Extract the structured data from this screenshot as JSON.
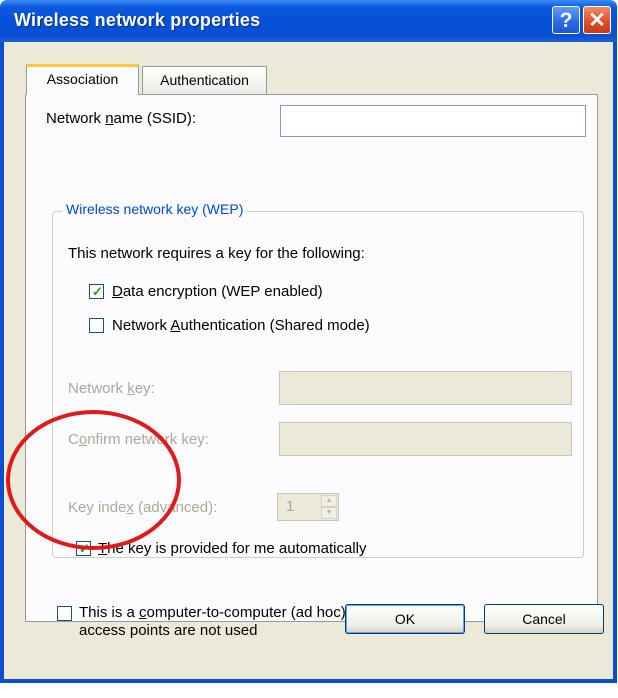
{
  "window": {
    "title": "Wireless network properties",
    "help_glyph": "?",
    "close_glyph": "✕"
  },
  "tabs": [
    {
      "label": "Association",
      "active": true
    },
    {
      "label": "Authentication",
      "active": false
    }
  ],
  "association": {
    "ssid_label_pre": "Network ",
    "ssid_label_accel": "n",
    "ssid_label_post": "ame (SSID):",
    "ssid_value": "",
    "group_title": "Wireless network key (WEP)",
    "requires_text": "This network requires a key for the following:",
    "data_encryption": {
      "accel": "D",
      "rest": "ata encryption (WEP enabled)",
      "checked": true
    },
    "network_auth": {
      "pre": "Network ",
      "accel": "A",
      "rest": "uthentication (Shared mode)",
      "checked": false
    },
    "network_key": {
      "pre": "Network ",
      "accel": "k",
      "rest": "ey:",
      "value": ""
    },
    "confirm_key": {
      "pre": "C",
      "accel": "o",
      "rest": "nfirm network key:",
      "value": ""
    },
    "key_index": {
      "pre": "Key inde",
      "accel": "x",
      "rest": " (advanced):",
      "value": "1"
    },
    "auto_key": {
      "accel": "T",
      "rest": "he key is provided for me automatically",
      "checked": true
    },
    "adhoc": {
      "pre": "This is a ",
      "accel": "c",
      "rest": "omputer-to-computer (ad hoc) network; wireless",
      "line2": "access points are not used",
      "checked": false
    }
  },
  "buttons": {
    "ok": "OK",
    "cancel": "Cancel"
  },
  "colors": {
    "titlebar": "#0452d8",
    "client": "#ece9d8",
    "annotation": "#e01a1a",
    "group_title": "#0046d5"
  }
}
